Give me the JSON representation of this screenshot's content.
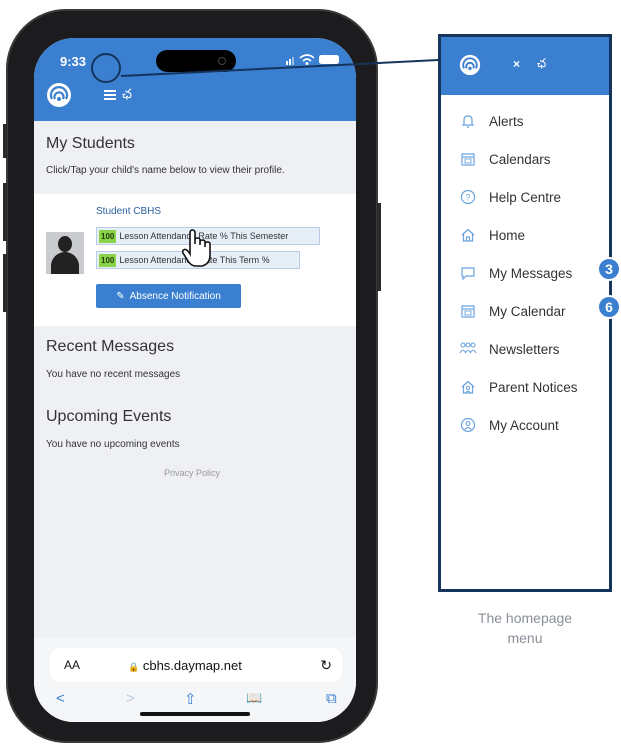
{
  "phone": {
    "status_time": "9:33",
    "header_glyph": "ఛ",
    "my_students_title": "My Students",
    "my_students_hint": "Click/Tap your child's name below to view their profile.",
    "student": {
      "name": "Student CBHS",
      "rates": [
        {
          "badge": "100",
          "label": "Lesson Attendance Rate % This Semester"
        },
        {
          "badge": "100",
          "label": "Lesson Attendance Rate This Term %"
        }
      ],
      "absence_button": "Absence Notification"
    },
    "recent_messages_title": "Recent Messages",
    "recent_messages_empty": "You have no recent messages",
    "upcoming_events_title": "Upcoming Events",
    "upcoming_events_empty": "You have no upcoming events",
    "privacy_link": "Privacy Policy",
    "browser": {
      "aa_label": "AA",
      "url": "cbhs.daymap.net",
      "lock": "🔒",
      "reload": "↻",
      "back": "<",
      "forward": ">",
      "share": "⇧",
      "bookmarks": "📖",
      "tabs": "⧉"
    }
  },
  "menu": {
    "close": "×",
    "glyph": "ఛ",
    "items": [
      {
        "label": "Alerts",
        "icon": "bell-icon",
        "glyph": "🔔"
      },
      {
        "label": "Calendars",
        "icon": "calendar-icon",
        "glyph": "▦"
      },
      {
        "label": "Help Centre",
        "icon": "help-icon",
        "glyph": "?"
      },
      {
        "label": "Home",
        "icon": "home-icon",
        "glyph": "⌂"
      },
      {
        "label": "My Messages",
        "icon": "message-icon",
        "glyph": "▭",
        "badge": "3"
      },
      {
        "label": "My Calendar",
        "icon": "calendar-icon",
        "glyph": "▦",
        "badge": "6"
      },
      {
        "label": "Newsletters",
        "icon": "people-icon",
        "glyph": "⚇"
      },
      {
        "label": "Parent Notices",
        "icon": "house-person-icon",
        "glyph": "⌂"
      },
      {
        "label": "My Account",
        "icon": "user-icon",
        "glyph": "◎"
      }
    ]
  },
  "caption_lines": [
    "The homepage",
    "menu"
  ],
  "colors": {
    "header_blue": "#3b7fd0",
    "frame_navy": "#16355c",
    "badge_green": "#8bd44a",
    "icon_blue": "#6aa2df"
  }
}
